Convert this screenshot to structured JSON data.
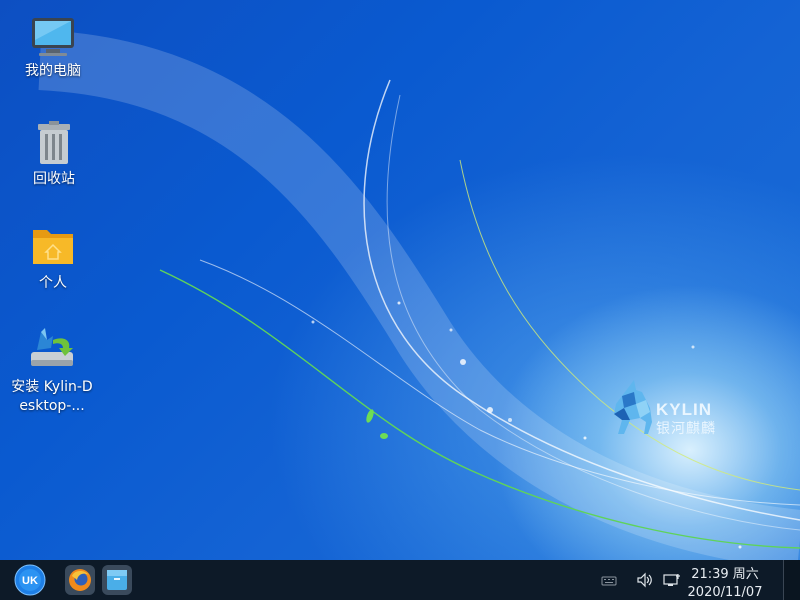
{
  "desktop": {
    "icons": [
      {
        "label": "我的电脑",
        "icon": "computer-icon"
      },
      {
        "label": "回收站",
        "icon": "trash-icon"
      },
      {
        "label": "个人",
        "icon": "home-folder-icon"
      },
      {
        "label": "安装 Kylin-Desktop-...",
        "icon": "installer-icon"
      }
    ],
    "wallpaper_logo": {
      "text": "KYLIN",
      "subtext": "银河麒麟"
    }
  },
  "taskbar": {
    "start_button": {
      "label": "UK",
      "icon": "start-menu-icon"
    },
    "pinned": [
      {
        "icon": "firefox-icon"
      },
      {
        "icon": "file-manager-icon"
      }
    ],
    "tray": [
      {
        "icon": "keyboard-icon"
      },
      {
        "icon": "volume-icon"
      },
      {
        "icon": "network-icon"
      }
    ],
    "clock": {
      "time": "21:39 周六",
      "date": "2020/11/07"
    }
  },
  "colors": {
    "taskbar_bg": "#0d1a28",
    "wallpaper_primary": "#0a5ad0",
    "folder": "#f5b31c"
  }
}
